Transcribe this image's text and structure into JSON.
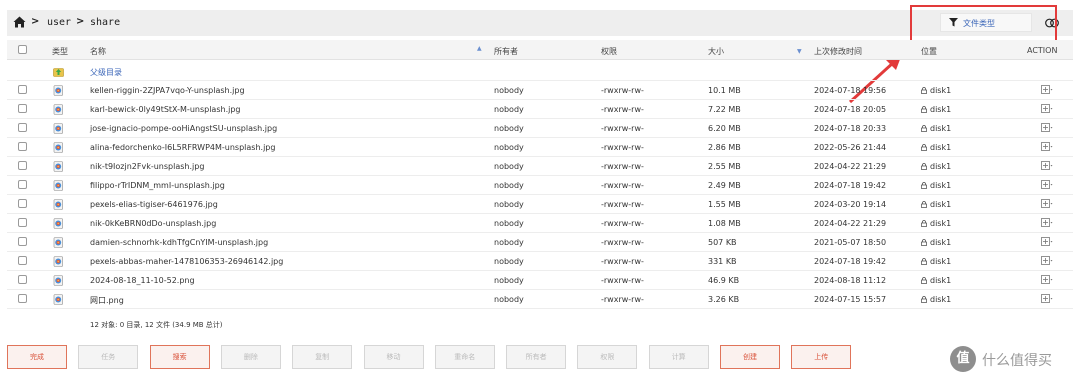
{
  "breadcrumb": {
    "home_icon": "home-icon",
    "separator": ">",
    "items": [
      "user",
      "share"
    ]
  },
  "filter": {
    "label": "文件类型",
    "icon": "filter-icon"
  },
  "toggle_icon": "toggle-icon",
  "columns": {
    "type": "类型",
    "name": "名称",
    "owner": "所有者",
    "permissions": "权限",
    "size": "大小",
    "modified": "上次修改时间",
    "location": "位置",
    "action": "ACTION"
  },
  "parent_dir": {
    "label": "父级目录",
    "icon": "folder-up-icon"
  },
  "rows": [
    {
      "name": "kellen-riggin-2ZJPA7vqo-Y-unsplash.jpg",
      "owner": "nobody",
      "perm": "-rwxrw-rw-",
      "size": "10.1 MB",
      "modified": "2024-07-18 19:56",
      "location": "disk1"
    },
    {
      "name": "karl-bewick-0ly49tStX-M-unsplash.jpg",
      "owner": "nobody",
      "perm": "-rwxrw-rw-",
      "size": "7.22 MB",
      "modified": "2024-07-18 20:05",
      "location": "disk1"
    },
    {
      "name": "jose-ignacio-pompe-ooHiAngstSU-unsplash.jpg",
      "owner": "nobody",
      "perm": "-rwxrw-rw-",
      "size": "6.20 MB",
      "modified": "2024-07-18 20:33",
      "location": "disk1"
    },
    {
      "name": "alina-fedorchenko-I6L5RFRWP4M-unsplash.jpg",
      "owner": "nobody",
      "perm": "-rwxrw-rw-",
      "size": "2.86 MB",
      "modified": "2022-05-26 21:44",
      "location": "disk1"
    },
    {
      "name": "nik-t9Iozjn2Fvk-unsplash.jpg",
      "owner": "nobody",
      "perm": "-rwxrw-rw-",
      "size": "2.55 MB",
      "modified": "2024-04-22 21:29",
      "location": "disk1"
    },
    {
      "name": "filippo-rTrIDNM_mmI-unsplash.jpg",
      "owner": "nobody",
      "perm": "-rwxrw-rw-",
      "size": "2.49 MB",
      "modified": "2024-07-18 19:42",
      "location": "disk1"
    },
    {
      "name": "pexels-elias-tigiser-6461976.jpg",
      "owner": "nobody",
      "perm": "-rwxrw-rw-",
      "size": "1.55 MB",
      "modified": "2024-03-20 19:14",
      "location": "disk1"
    },
    {
      "name": "nik-0kKeBRN0dDo-unsplash.jpg",
      "owner": "nobody",
      "perm": "-rwxrw-rw-",
      "size": "1.08 MB",
      "modified": "2024-04-22 21:29",
      "location": "disk1"
    },
    {
      "name": "damien-schnorhk-kdhTfgCnYIM-unsplash.jpg",
      "owner": "nobody",
      "perm": "-rwxrw-rw-",
      "size": "507 KB",
      "modified": "2021-05-07 18:50",
      "location": "disk1"
    },
    {
      "name": "pexels-abbas-maher-1478106353-26946142.jpg",
      "owner": "nobody",
      "perm": "-rwxrw-rw-",
      "size": "331 KB",
      "modified": "2024-07-18 19:42",
      "location": "disk1"
    },
    {
      "name": "2024-08-18_11-10-52.png",
      "owner": "nobody",
      "perm": "-rwxrw-rw-",
      "size": "46.9 KB",
      "modified": "2024-08-18 11:12",
      "location": "disk1"
    },
    {
      "name": "网口.png",
      "owner": "nobody",
      "perm": "-rwxrw-rw-",
      "size": "3.26 KB",
      "modified": "2024-07-15 15:57",
      "location": "disk1"
    }
  ],
  "summary": "12 对象: 0 目录, 12 文件 (34.9 MB 总计)",
  "buttons": [
    {
      "label": "完成",
      "active": true
    },
    {
      "label": "任务",
      "active": false
    },
    {
      "label": "搜索",
      "active": true
    },
    {
      "label": "删除",
      "active": false
    },
    {
      "label": "复制",
      "active": false
    },
    {
      "label": "移动",
      "active": false
    },
    {
      "label": "重命名",
      "active": false
    },
    {
      "label": "所有者",
      "active": false
    },
    {
      "label": "权限",
      "active": false
    },
    {
      "label": "计算",
      "active": false
    },
    {
      "label": "创建",
      "active": true
    },
    {
      "label": "上传",
      "active": true
    }
  ],
  "watermark": {
    "badge": "值",
    "text": "什么值得买"
  },
  "colors": {
    "accent_red": "#e23a3a",
    "link_blue": "#3b66b8",
    "button_active": "#d9523a"
  }
}
